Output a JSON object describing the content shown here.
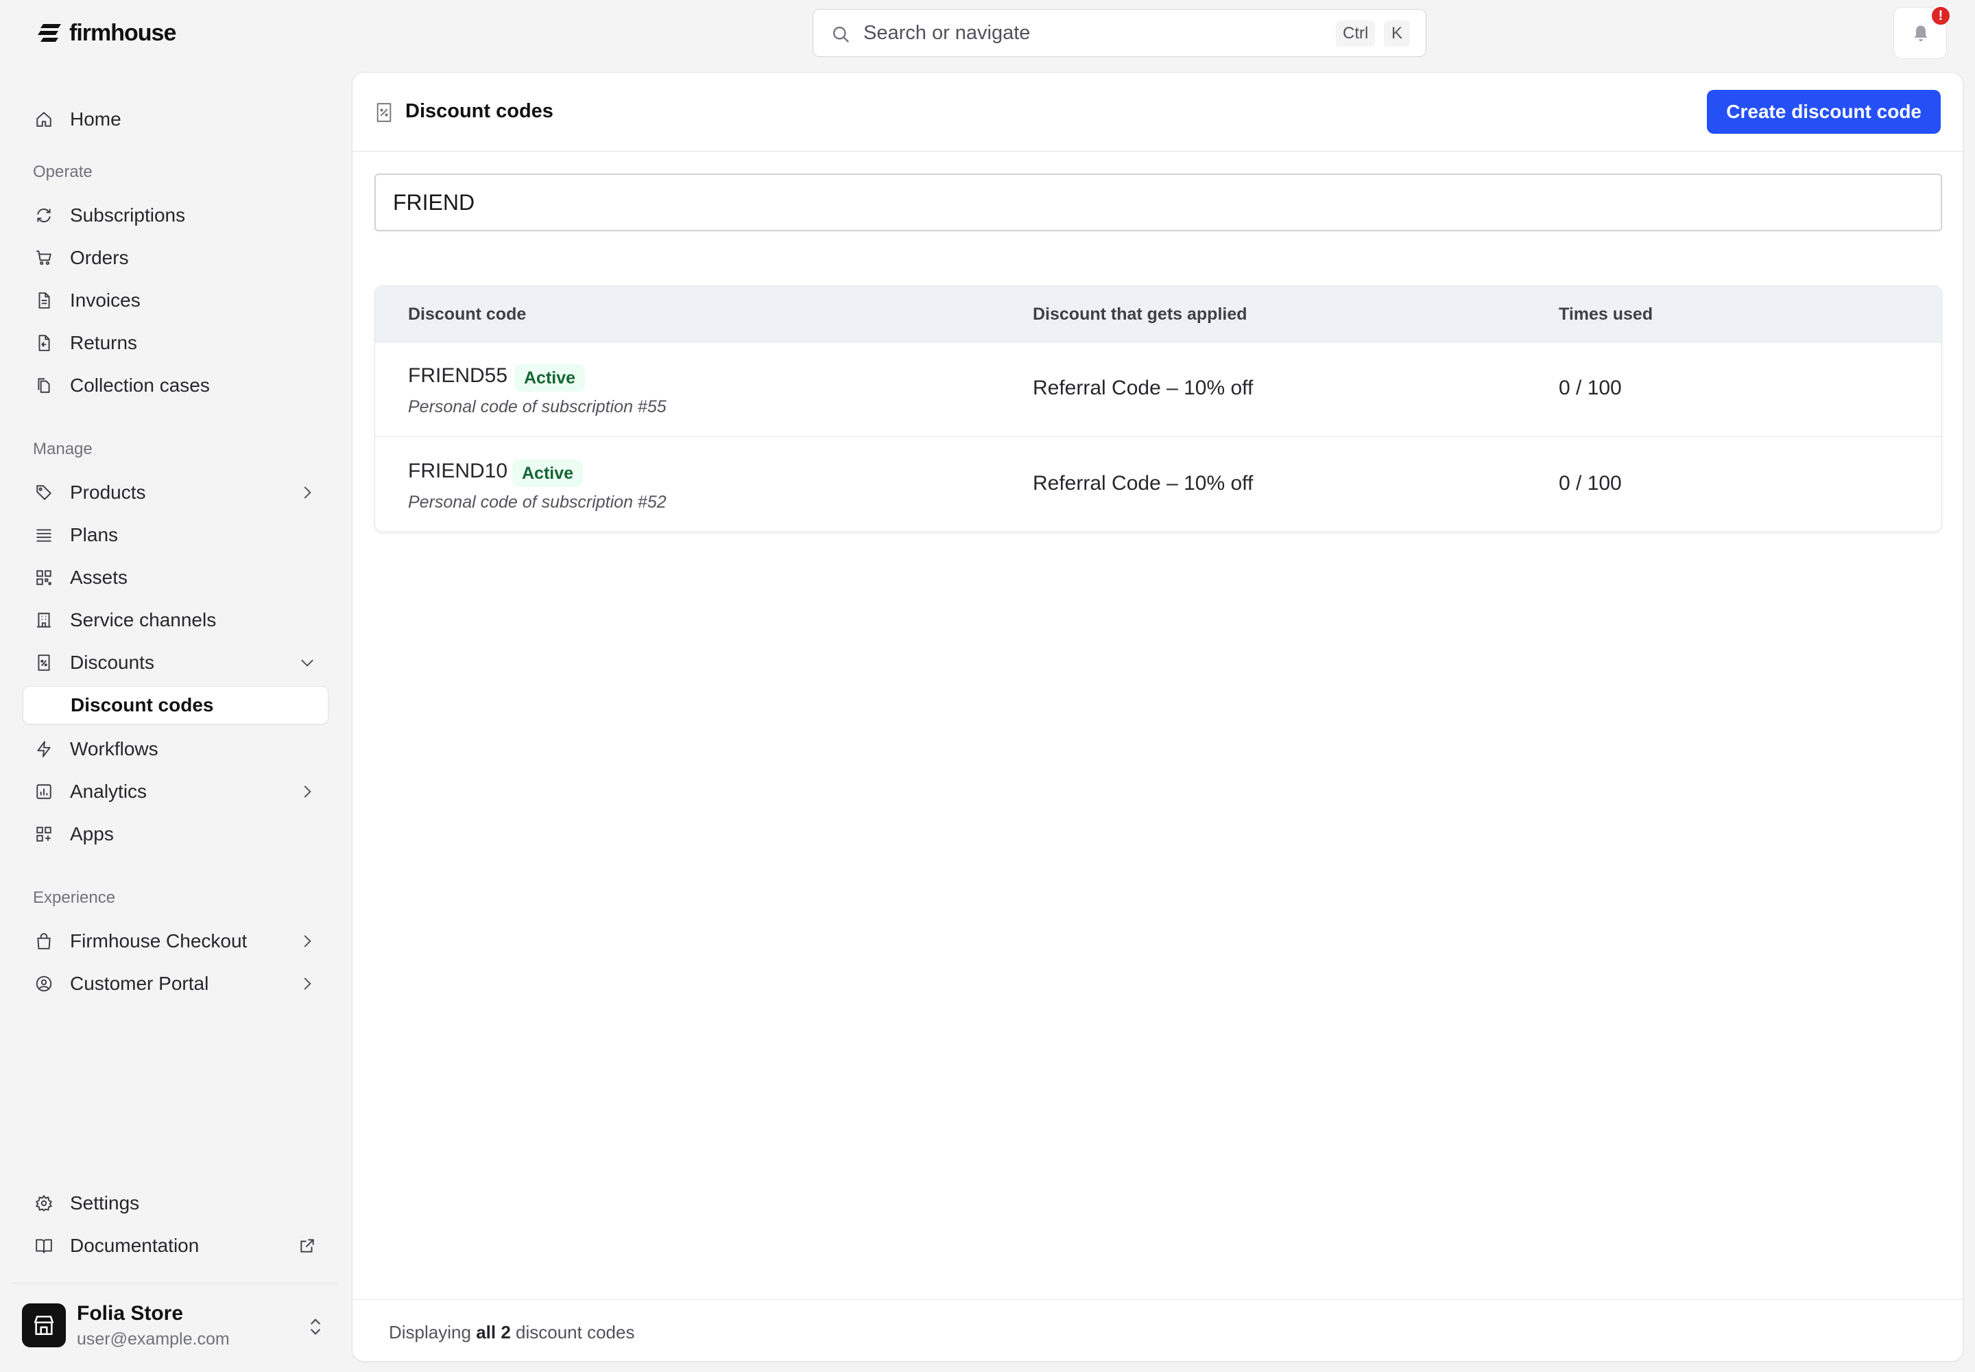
{
  "brand": {
    "name": "firmhouse"
  },
  "search": {
    "placeholder": "Search or navigate",
    "shortcut_mod": "Ctrl",
    "shortcut_key": "K"
  },
  "notifications": {
    "badge": "!"
  },
  "sidebar": {
    "home": "Home",
    "sections": {
      "operate": "Operate",
      "manage": "Manage",
      "experience": "Experience"
    },
    "operate_items": [
      "Subscriptions",
      "Orders",
      "Invoices",
      "Returns",
      "Collection cases"
    ],
    "manage_items": [
      "Products",
      "Plans",
      "Assets",
      "Service channels",
      "Discounts",
      "Discount codes",
      "Workflows",
      "Analytics",
      "Apps"
    ],
    "experience_items": [
      "Firmhouse Checkout",
      "Customer Portal"
    ],
    "settings": "Settings",
    "documentation": "Documentation",
    "store": {
      "name": "Folia Store",
      "email": "user@example.com"
    }
  },
  "page": {
    "title": "Discount codes",
    "create_button": "Create discount code",
    "filter_value": "FRIEND"
  },
  "table": {
    "headers": [
      "Discount code",
      "Discount that gets applied",
      "Times used"
    ],
    "rows": [
      {
        "code": "FRIEND55",
        "status": "Active",
        "description": "Personal code of subscription #55",
        "discount": "Referral Code – 10% off",
        "used": "0 / 100"
      },
      {
        "code": "FRIEND10",
        "status": "Active",
        "description": "Personal code of subscription #52",
        "discount": "Referral Code – 10% off",
        "used": "0 / 100"
      }
    ]
  },
  "footer": {
    "prefix": "Displaying",
    "count": "all 2",
    "suffix": "discount codes"
  },
  "colors": {
    "accent": "#2450f5",
    "active_badge_bg": "#ecfdf3",
    "active_badge_text": "#166534",
    "alert": "#dc2626"
  }
}
